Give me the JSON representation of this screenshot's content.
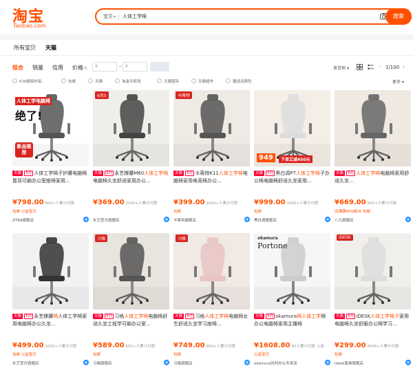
{
  "header": {
    "logo_cn": "淘宝",
    "logo_en": "Taobao.com",
    "search_scope": "宝贝",
    "search_query": "人体工学椅",
    "search_button": "搜索"
  },
  "tabs": [
    "所有宝贝",
    "天猫"
  ],
  "sort": {
    "items": [
      "综合",
      "销量",
      "信用",
      "价格"
    ],
    "price_min_placeholder": "¥",
    "price_max_placeholder": "¥",
    "ship_from": "发货地",
    "page_indicator": "1/100"
  },
  "filters": [
    "618超级补贴",
    "包邮",
    "天猫",
    "淘金币抵钱",
    "天猫国际",
    "天猫超市",
    "赠送运费险"
  ],
  "filters_more": "更多",
  "products": [
    {
      "title_pre": "人体工学椅子护腰电脑椅靠背可躺办公室座椅家用...",
      "highlight": "",
      "title_post": "",
      "price": "¥798.00",
      "sales": "800+人累计付款",
      "benefit": "包邮 公益宝贝",
      "shop": "ZTRA旗舰店",
      "overlay1": "人体工学电脑椅",
      "overlay2": "绝了!",
      "overlay3": "新品推荐",
      "badge": ""
    },
    {
      "title_pre": "永艺撑腰M60",
      "highlight": "人体工学椅",
      "title_post": "电脑椅久坐舒适家用办公...",
      "price": "¥369.00",
      "sales": "1000+人累计付款",
      "benefit": "",
      "shop": "永艺官方旗舰店",
      "overlay1": "",
      "overlay2": "",
      "overlay3": "",
      "badge": "6月5"
    },
    {
      "title_pre": "卡蒋特K11",
      "highlight": "人体工学椅",
      "title_post": "电脑椅家用电竞椅办公...",
      "price": "¥399.00",
      "sales": "1000+人累计付款",
      "benefit": "包邮",
      "shop": "卡蒋特旗舰店",
      "overlay1": "",
      "overlay2": "",
      "overlay3": "",
      "badge": "卡蒋特"
    },
    {
      "title_pre": "黑白调P7",
      "highlight": "人体工学椅",
      "title_post": "子办公椅电脑椅舒适久坐家用...",
      "price": "¥999.00",
      "sales": "1000+人累计付款",
      "benefit": "包邮",
      "shop": "黑白调旗舰店",
      "overlay1": "949",
      "overlay2": "下单立减450元",
      "overlay3": "",
      "badge": ""
    },
    {
      "title_pre": "",
      "highlight": "人体工学椅",
      "title_post": "电脑椅家用舒适久坐...",
      "price": "¥669.00",
      "sales": "500+人累计付款",
      "benefit": "店铺满669减30 包邮",
      "shop": "八九旗舰店",
      "overlay1": "",
      "overlay2": "",
      "overlay3": "",
      "badge": ""
    },
    {
      "title_pre": "永艺撑腰",
      "highlight": "椅",
      "title_post": "人体工学椅家用电脑椅办公久坐...",
      "price": "¥499.00",
      "sales": "1000+人累计付款",
      "benefit": "包邮 公益宝贝",
      "shop": "永艺官方旗舰店",
      "overlay1": "",
      "overlay2": "",
      "overlay3": "",
      "badge": ""
    },
    {
      "title_pre": "习格",
      "highlight": "人体工学椅",
      "title_post": "电脑椅舒适久坐工程学可躺办公室...",
      "price": "¥589.00",
      "sales": "600+人累计付款",
      "benefit": "包邮",
      "shop": "习格旗舰店",
      "overlay1": "",
      "overlay2": "",
      "overlay3": "",
      "badge": "习格"
    },
    {
      "title_pre": "习格",
      "highlight": "人体工学椅",
      "title_post": "电脑椅女生舒适久坐学习座椅...",
      "price": "¥749.00",
      "sales": "800+人累计付款",
      "benefit": "包邮",
      "shop": "习格旗舰店",
      "overlay1": "",
      "overlay2": "",
      "overlay3": "",
      "badge": "习格"
    },
    {
      "title_pre": "okamura",
      "highlight": "椅人体工学",
      "title_post": "椅办公电脑椅家用主播椅",
      "price": "¥1608.80",
      "sales": "90人累计付款 上海",
      "benefit": "公益宝贝",
      "shop": "okamura冈村办公专卖店",
      "overlay1": "okamura",
      "overlay2": "Portone",
      "overlay3": "",
      "badge": ""
    },
    {
      "title_pre": "iDESK",
      "highlight": "人体工学椅子",
      "title_post": "家用电脑椅久坐舒服办公椅学习...",
      "price": "¥299.00",
      "sales": "4000+人累计付款",
      "benefit": "包邮",
      "shop": "idesk家具旗舰店",
      "overlay1": "",
      "overlay2": "",
      "overlay3": "",
      "badge": "iDESK"
    }
  ],
  "colors": {
    "brand": "#ff5000",
    "tmall": "#ff0036",
    "wangwang": "#1a90ff"
  }
}
